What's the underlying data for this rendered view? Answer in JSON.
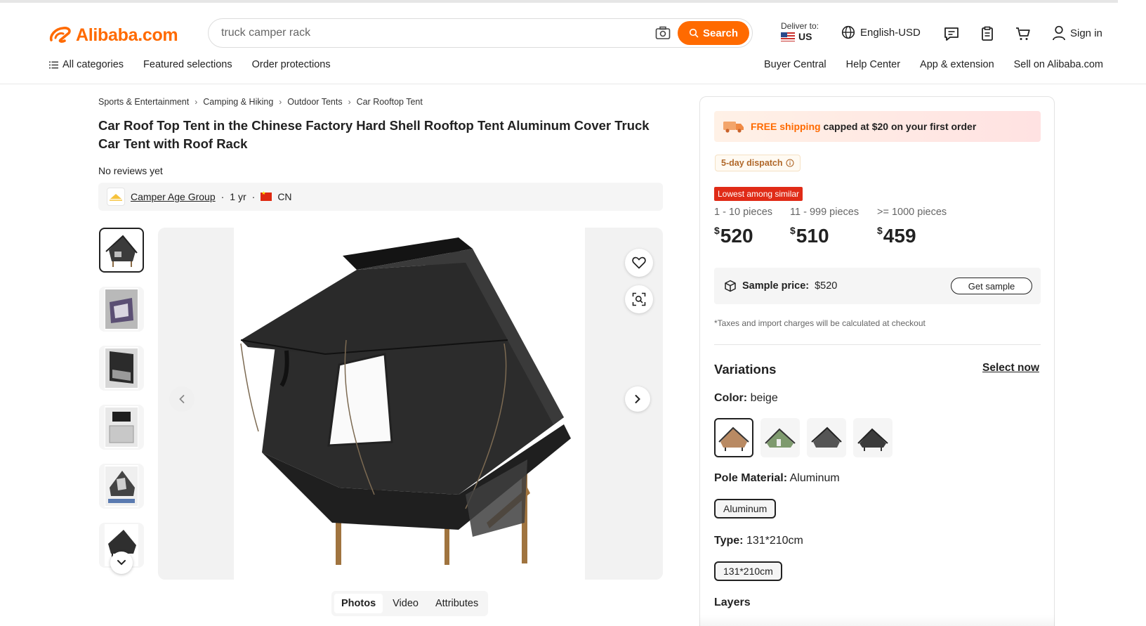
{
  "header": {
    "logo_text": "Alibaba.com",
    "search_value": "truck camper rack",
    "search_button": "Search",
    "deliver_label": "Deliver to:",
    "deliver_country": "US",
    "language": "English-USD",
    "signin": "Sign in",
    "nav_left": [
      "All categories",
      "Featured selections",
      "Order protections"
    ],
    "nav_right": [
      "Buyer Central",
      "Help Center",
      "App & extension",
      "Sell on Alibaba.com"
    ]
  },
  "breadcrumb": [
    "Sports & Entertainment",
    "Camping & Hiking",
    "Outdoor Tents",
    "Car Rooftop Tent"
  ],
  "product": {
    "title": "Car Roof Top Tent in the Chinese Factory Hard Shell Rooftop Tent Aluminum Cover Truck Car Tent with Roof Rack",
    "reviews": "No reviews yet",
    "supplier_name": "Camper Age Group",
    "supplier_years": "1 yr",
    "supplier_country": "CN",
    "media_tabs": [
      "Photos",
      "Video",
      "Attributes"
    ]
  },
  "purchase": {
    "shipping_free": "FREE shipping",
    "shipping_rest": "capped at $20 on your first order",
    "dispatch": "5-day dispatch",
    "lowest_badge": "Lowest among similar",
    "tiers": [
      {
        "qty": "1 - 10 pieces",
        "currency": "$",
        "price": "520"
      },
      {
        "qty": "11 - 999 pieces",
        "currency": "$",
        "price": "510"
      },
      {
        "qty": ">= 1000 pieces",
        "currency": "$",
        "price": "459"
      }
    ],
    "sample_label": "Sample price:",
    "sample_price": "$520",
    "sample_button": "Get sample",
    "taxes_note": "*Taxes and import charges will be calculated at checkout",
    "variations_title": "Variations",
    "select_now": "Select now",
    "color_label": "Color:",
    "color_value": "beige",
    "pole_label": "Pole Material:",
    "pole_value": "Aluminum",
    "pole_option": "Aluminum",
    "type_label": "Type:",
    "type_value": "131*210cm",
    "type_option": "131*210cm",
    "layers_label": "Layers"
  },
  "colors": {
    "brand": "#ff6a00",
    "badge_red": "#e02b17"
  }
}
